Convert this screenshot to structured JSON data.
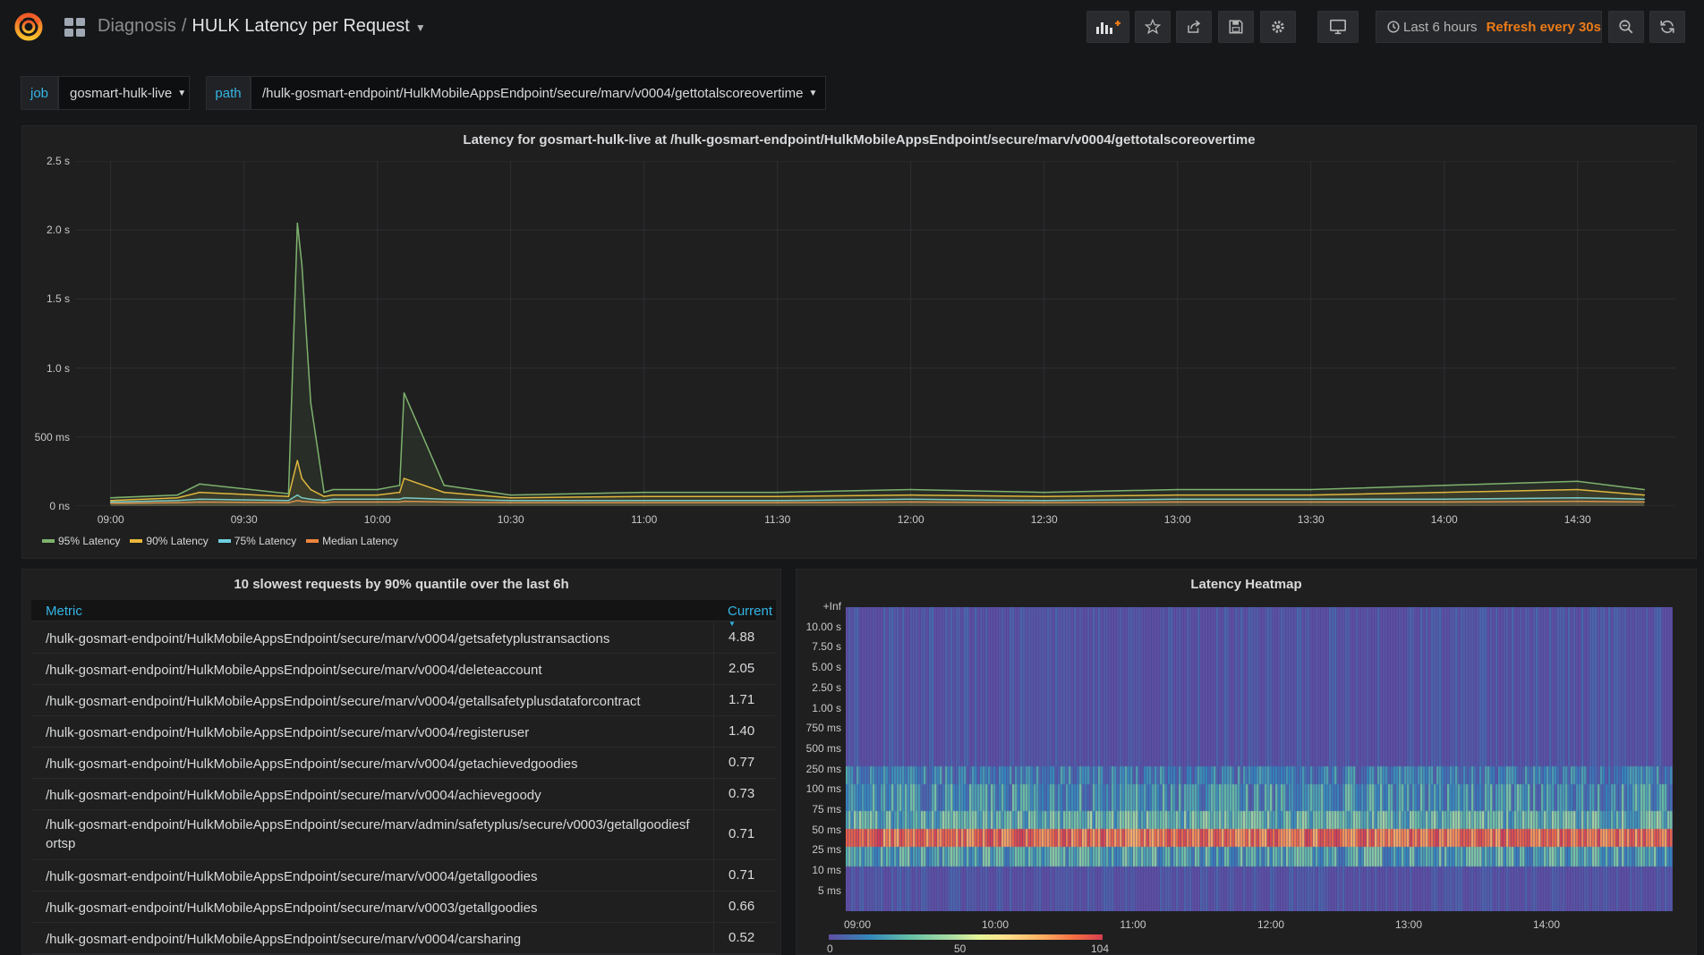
{
  "breadcrumb": {
    "folder": "Diagnosis",
    "separator": "/",
    "title": "HULK Latency per Request"
  },
  "toolbar": {
    "time_range": "Last 6 hours",
    "refresh": "Refresh every 30s"
  },
  "icons": [
    "grafana-logo-icon",
    "dashboard-grid-icon",
    "add-panel-icon",
    "star-icon",
    "share-icon",
    "save-icon",
    "settings-icon",
    "tv-mode-icon",
    "clock-icon",
    "zoom-out-icon",
    "refresh-icon"
  ],
  "colors": {
    "series_95": "#7eb26d",
    "series_90": "#eab839",
    "series_75": "#6ed0e0",
    "series_median": "#ef843c",
    "accent_blue": "#33b5e5",
    "refresh_orange": "#eb7b18"
  },
  "variables": [
    {
      "label": "job",
      "value": "gosmart-hulk-live"
    },
    {
      "label": "path",
      "value": "/hulk-gosmart-endpoint/HulkMobileAppsEndpoint/secure/marv/v0004/gettotalscoreovertime"
    }
  ],
  "graph_panel": {
    "title": "Latency for gosmart-hulk-live at /hulk-gosmart-endpoint/HulkMobileAppsEndpoint/secure/marv/v0004/gettotalscoreovertime",
    "y_ticks": [
      "0 ns",
      "500 ms",
      "1.0 s",
      "1.5 s",
      "2.0 s",
      "2.5 s"
    ],
    "x_ticks": [
      "09:00",
      "09:30",
      "10:00",
      "10:30",
      "11:00",
      "11:30",
      "12:00",
      "12:30",
      "13:00",
      "13:30",
      "14:00",
      "14:30"
    ],
    "legend": [
      "95% Latency",
      "90% Latency",
      "75% Latency",
      "Median Latency"
    ]
  },
  "chart_data": {
    "type": "line",
    "title": "Latency for gosmart-hulk-live at /hulk-gosmart-endpoint/HulkMobileAppsEndpoint/secure/marv/v0004/gettotalscoreovertime",
    "xlabel": "",
    "ylabel": "",
    "x_unit": "time",
    "y_unit": "seconds",
    "xlim": [
      "08:52",
      "14:52"
    ],
    "ylim": [
      0,
      2.5
    ],
    "grid": true,
    "legend_position": "bottom-left",
    "x": [
      "09:00",
      "09:15",
      "09:20",
      "09:40",
      "09:42",
      "09:43",
      "09:45",
      "09:48",
      "09:50",
      "10:00",
      "10:05",
      "10:06",
      "10:15",
      "10:30",
      "11:00",
      "11:30",
      "12:00",
      "12:30",
      "13:00",
      "13:30",
      "14:00",
      "14:30",
      "14:45"
    ],
    "series": [
      {
        "name": "95% Latency",
        "values": [
          0.06,
          0.08,
          0.16,
          0.09,
          2.05,
          1.75,
          0.75,
          0.1,
          0.12,
          0.12,
          0.15,
          0.82,
          0.15,
          0.08,
          0.1,
          0.1,
          0.12,
          0.1,
          0.12,
          0.12,
          0.15,
          0.18,
          0.12
        ]
      },
      {
        "name": "90% Latency",
        "values": [
          0.04,
          0.06,
          0.1,
          0.07,
          0.33,
          0.2,
          0.12,
          0.07,
          0.08,
          0.08,
          0.1,
          0.2,
          0.1,
          0.06,
          0.07,
          0.07,
          0.08,
          0.07,
          0.08,
          0.08,
          0.1,
          0.12,
          0.08
        ]
      },
      {
        "name": "75% Latency",
        "values": [
          0.03,
          0.04,
          0.05,
          0.04,
          0.08,
          0.06,
          0.05,
          0.04,
          0.05,
          0.05,
          0.05,
          0.06,
          0.05,
          0.04,
          0.04,
          0.04,
          0.05,
          0.04,
          0.05,
          0.05,
          0.05,
          0.06,
          0.05
        ]
      },
      {
        "name": "Median Latency",
        "values": [
          0.02,
          0.025,
          0.03,
          0.025,
          0.04,
          0.035,
          0.03,
          0.025,
          0.03,
          0.03,
          0.03,
          0.035,
          0.03,
          0.025,
          0.025,
          0.025,
          0.03,
          0.025,
          0.03,
          0.03,
          0.03,
          0.035,
          0.03
        ]
      }
    ]
  },
  "table_panel": {
    "title": "10 slowest requests by 90% quantile over the last 6h",
    "col_metric": "Metric",
    "col_current": "Current",
    "rows": [
      {
        "metric": "/hulk-gosmart-endpoint/HulkMobileAppsEndpoint/secure/marv/v0004/getsafetyplustransactions",
        "current": "4.88"
      },
      {
        "metric": "/hulk-gosmart-endpoint/HulkMobileAppsEndpoint/secure/marv/v0004/deleteaccount",
        "current": "2.05"
      },
      {
        "metric": "/hulk-gosmart-endpoint/HulkMobileAppsEndpoint/secure/marv/v0004/getallsafetyplusdataforcontract",
        "current": "1.71"
      },
      {
        "metric": "/hulk-gosmart-endpoint/HulkMobileAppsEndpoint/secure/marv/v0004/registeruser",
        "current": "1.40"
      },
      {
        "metric": "/hulk-gosmart-endpoint/HulkMobileAppsEndpoint/secure/marv/v0004/getachievedgoodies",
        "current": "0.77"
      },
      {
        "metric": "/hulk-gosmart-endpoint/HulkMobileAppsEndpoint/secure/marv/v0004/achievegoody",
        "current": "0.73"
      },
      {
        "metric": "/hulk-gosmart-endpoint/HulkMobileAppsEndpoint/secure/marv/admin/safetyplus/secure/v0003/getallgoodiesfortsp",
        "current": "0.71"
      },
      {
        "metric": "/hulk-gosmart-endpoint/HulkMobileAppsEndpoint/secure/marv/v0004/getallgoodies",
        "current": "0.71"
      },
      {
        "metric": "/hulk-gosmart-endpoint/HulkMobileAppsEndpoint/secure/marv/v0003/getallgoodies",
        "current": "0.66"
      },
      {
        "metric": "/hulk-gosmart-endpoint/HulkMobileAppsEndpoint/secure/marv/v0004/carsharing",
        "current": "0.52"
      }
    ]
  },
  "heatmap_panel": {
    "title": "Latency Heatmap",
    "y_ticks": [
      "+Inf",
      "10.00 s",
      "7.50 s",
      "5.00 s",
      "2.50 s",
      "1.00 s",
      "750 ms",
      "500 ms",
      "250 ms",
      "100 ms",
      "75 ms",
      "50 ms",
      "25 ms",
      "10 ms",
      "5 ms"
    ],
    "x_ticks": [
      "09:00",
      "10:00",
      "11:00",
      "12:00",
      "13:00",
      "14:00"
    ],
    "scale_labels": [
      "0",
      "50",
      "104"
    ]
  }
}
